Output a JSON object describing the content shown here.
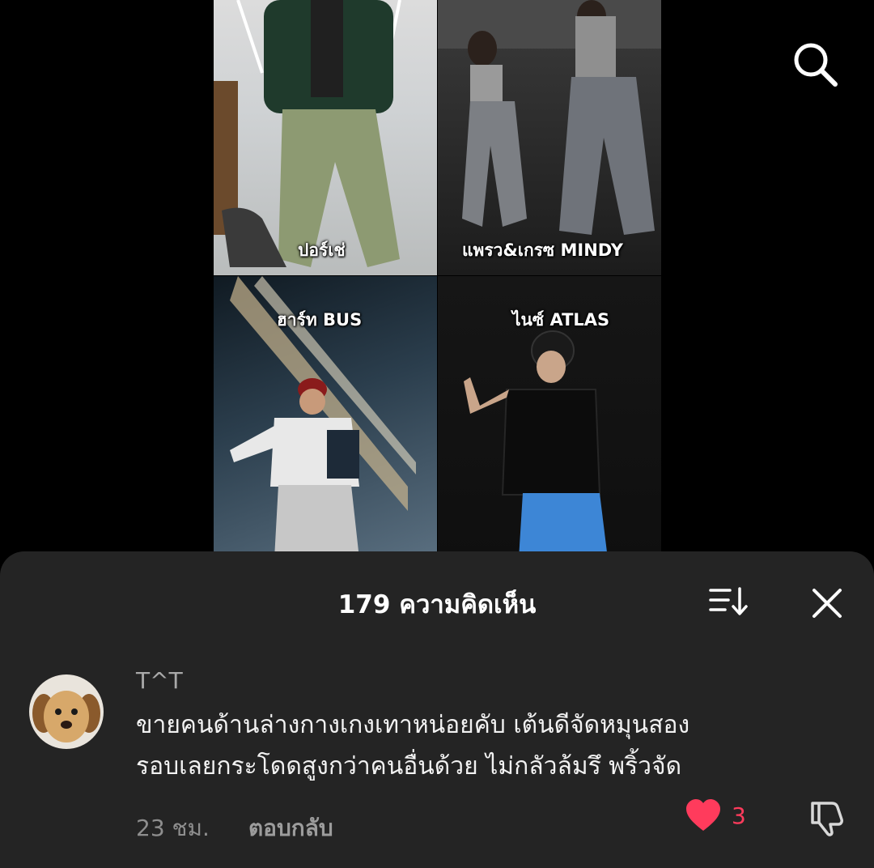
{
  "video": {
    "captions": [
      "ปอร์เช่",
      "แพรว&เกรซ MINDY",
      "ฮาร์ท BUS",
      "ไนซ์ ATLAS"
    ]
  },
  "comments_panel": {
    "title": "179 ความคิดเห็น"
  },
  "comment": {
    "username": "T^T",
    "lines": [
      "ขายคนด้านล่างกางเกงเทาหน่อยคับ เต้นดีจัดหมุนสอง",
      "รอบเลยกระโดดสูงกว่าคนอื่นด้วย ไม่กลัวล้มรึ พริ้วจัด"
    ],
    "time": "23 ชม.",
    "reply_label": "ตอบกลับ",
    "likes": "3"
  },
  "colors": {
    "sheet_bg": "#242424",
    "like_red": "#ff3b5c"
  }
}
